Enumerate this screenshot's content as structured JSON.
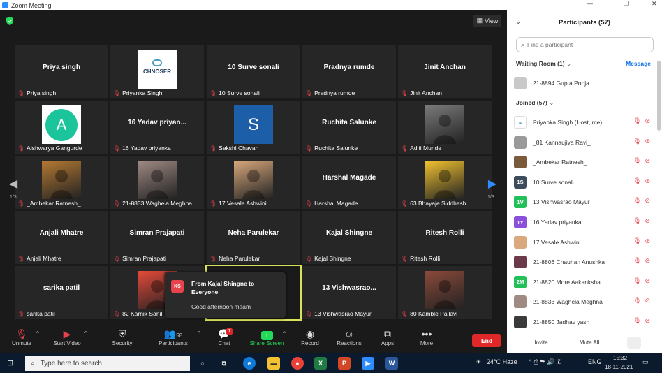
{
  "window": {
    "title": "Zoom Meeting",
    "controls": [
      "—",
      "❐",
      "✕"
    ]
  },
  "meeting": {
    "view_label": "View",
    "page_left": "1/3",
    "page_right": "1/3",
    "tiles": [
      {
        "big": "Priya singh",
        "label": "Priya singh"
      },
      {
        "pic": "logo",
        "label": "Priyanka Singh",
        "pic_text": "CHNOSER"
      },
      {
        "big": "10 Surve sonali",
        "label": "10 Surve sonali"
      },
      {
        "big": "Pradnya rumde",
        "label": "Pradnya rumde"
      },
      {
        "big": "Jinit Anchan",
        "label": "Jinit Anchan"
      },
      {
        "pic": "A",
        "pic_color": "#1bc49a",
        "label": "Aishwarya Gangurde"
      },
      {
        "big": "16  Yadav priyan...",
        "label": "16  Yadav priyanka"
      },
      {
        "pic": "S",
        "pic_color": "#1c5fa8",
        "label": "Sakshi Chavan"
      },
      {
        "big": "Ruchita Salunke",
        "label": "Ruchita Salunke"
      },
      {
        "pic": "photo",
        "pic_color": "#7a7a7a",
        "label": "Aditi Munde"
      },
      {
        "pic": "photo",
        "pic_color": "#b57a33",
        "label": "_Ambekar Ratnesh_"
      },
      {
        "pic": "photo",
        "pic_color": "#a08a84",
        "label": "21-8833 Waghela Meghna"
      },
      {
        "pic": "photo",
        "pic_color": "#d9a87c",
        "label": "17 Vesale Ashwini"
      },
      {
        "big": "Harshal Magade",
        "label": "Harshal Magade"
      },
      {
        "pic": "photo",
        "pic_color": "#f2c230",
        "label": "63 Bhayaje Siddhesh"
      },
      {
        "big": "Anjali Mhatre",
        "label": "Anjali Mhatre"
      },
      {
        "big": "Simran Prajapati",
        "label": "Simran Prajapati"
      },
      {
        "big": "Neha Parulekar",
        "label": "Neha Parulekar"
      },
      {
        "big": "Kajal Shingne",
        "label": "Kajal Shingne"
      },
      {
        "big": "Ritesh Rolli",
        "label": "Ritesh Rolli"
      },
      {
        "big": "sarika patil",
        "label": "sarika patil"
      },
      {
        "pic": "photo",
        "pic_color": "#e64a3a",
        "label": "82 Karnik Sanil"
      },
      {
        "big": "",
        "label": ""
      },
      {
        "big": "13  Vishwasrao...",
        "label": "13 Vishwasrao Mayur"
      },
      {
        "pic": "photo",
        "pic_color": "#8a4a3a",
        "label": "80 Kamble Pallavi"
      }
    ]
  },
  "chat_popup": {
    "avatar": "KS",
    "from": "From Kajal Shingne to Everyone",
    "message": "Good afternoon maam"
  },
  "toolbar": {
    "unmute": "Unmute",
    "start_video": "Start Video",
    "security": "Security",
    "participants": "Participants",
    "participants_count": "58",
    "chat": "Chat",
    "chat_badge": "1",
    "share_screen": "Share Screen",
    "record": "Record",
    "reactions": "Reactions",
    "apps": "Apps",
    "more": "More",
    "end": "End"
  },
  "panel": {
    "title": "Participants (57)",
    "search_placeholder": "Find a participant",
    "waiting_room": "Waiting Room (1)",
    "message": "Message",
    "waiting_person": "21-8894 Gupta Pooja",
    "joined": "Joined (57)",
    "people": [
      {
        "av": "",
        "color": "#ffffff",
        "name": "Priyanka Singh (Host, me)"
      },
      {
        "av": "",
        "color": "#9a9a9a",
        "name": "_81 Kannaujiya Ravi_"
      },
      {
        "av": "",
        "color": "#7a5a3a",
        "name": "_Ambekar Ratnesh_"
      },
      {
        "av": "1S",
        "color": "#3c4c5c",
        "name": "10 Surve sonali"
      },
      {
        "av": "1V",
        "color": "#23c05a",
        "name": "13 Vishwasrao Mayur"
      },
      {
        "av": "1Y",
        "color": "#8b50d9",
        "name": "16  Yadav priyanka"
      },
      {
        "av": "",
        "color": "#d9a87c",
        "name": "17 Vesale Ashwini"
      },
      {
        "av": "",
        "color": "#6a3a4a",
        "name": "21-8806 Chauhan Anushka"
      },
      {
        "av": "2M",
        "color": "#23c05a",
        "name": "21-8820 More Aakanksha"
      },
      {
        "av": "",
        "color": "#a08a84",
        "name": "21-8833 Waghela Meghna"
      },
      {
        "av": "",
        "color": "#3a3a3a",
        "name": "21-8850 Jadhav yash"
      }
    ],
    "invite": "Invite",
    "mute_all": "Mute All",
    "more": "..."
  },
  "taskbar": {
    "search": "Type here to search",
    "weather": "24°C  Haze",
    "lang": "ENG",
    "time": "15:32",
    "date": "18-11-2021"
  }
}
